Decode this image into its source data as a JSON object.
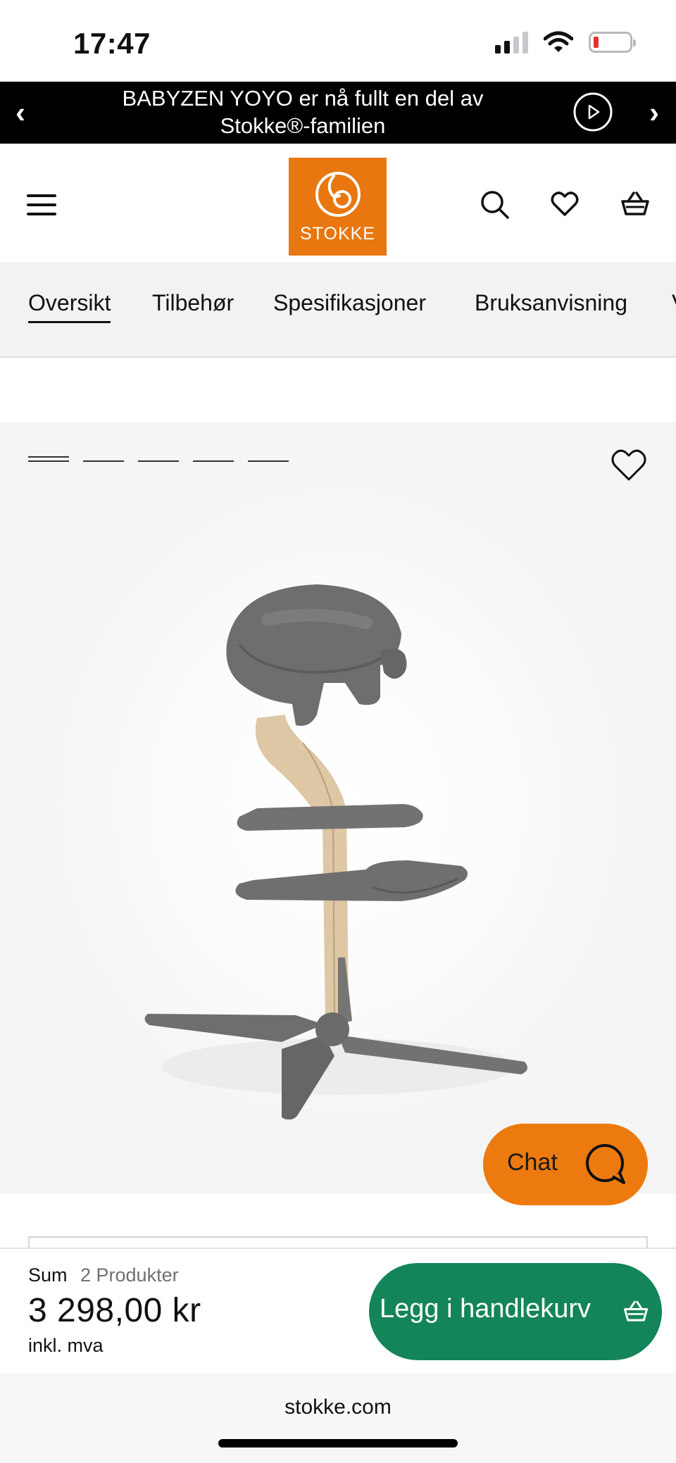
{
  "status_bar": {
    "time": "17:47",
    "signal_bars": 2,
    "battery_level": 0.1
  },
  "banner": {
    "text": "BABYZEN YOYO er nå fullt en del av Stokke®-familien",
    "prev_icon": "chevron-left-icon",
    "next_icon": "chevron-right-icon",
    "play_icon": "play-circle-icon"
  },
  "header": {
    "logo_text": "STOKKE",
    "brand_color": "#e8770f",
    "icons": [
      "menu-icon",
      "search-icon",
      "heart-icon",
      "basket-icon"
    ]
  },
  "tabs": [
    {
      "label": "Oversikt",
      "active": true
    },
    {
      "label": "Tilbehør",
      "active": false
    },
    {
      "label": "Spesifikasjoner",
      "active": false
    },
    {
      "label": "Bruksanvisning",
      "active": false
    },
    {
      "label": "V",
      "active": false
    }
  ],
  "gallery": {
    "image_count": 5,
    "current_image": 1
  },
  "chat": {
    "label": "Chat",
    "color": "#ed7a0e"
  },
  "cart": {
    "sum_label": "Sum",
    "products_count": "2 Produkter",
    "price": "3 298,00 kr",
    "vat_note": "inkl. mva",
    "button_label": "Legg i handlekurv",
    "button_color": "#138559"
  },
  "browser": {
    "url": "stokke.com"
  }
}
